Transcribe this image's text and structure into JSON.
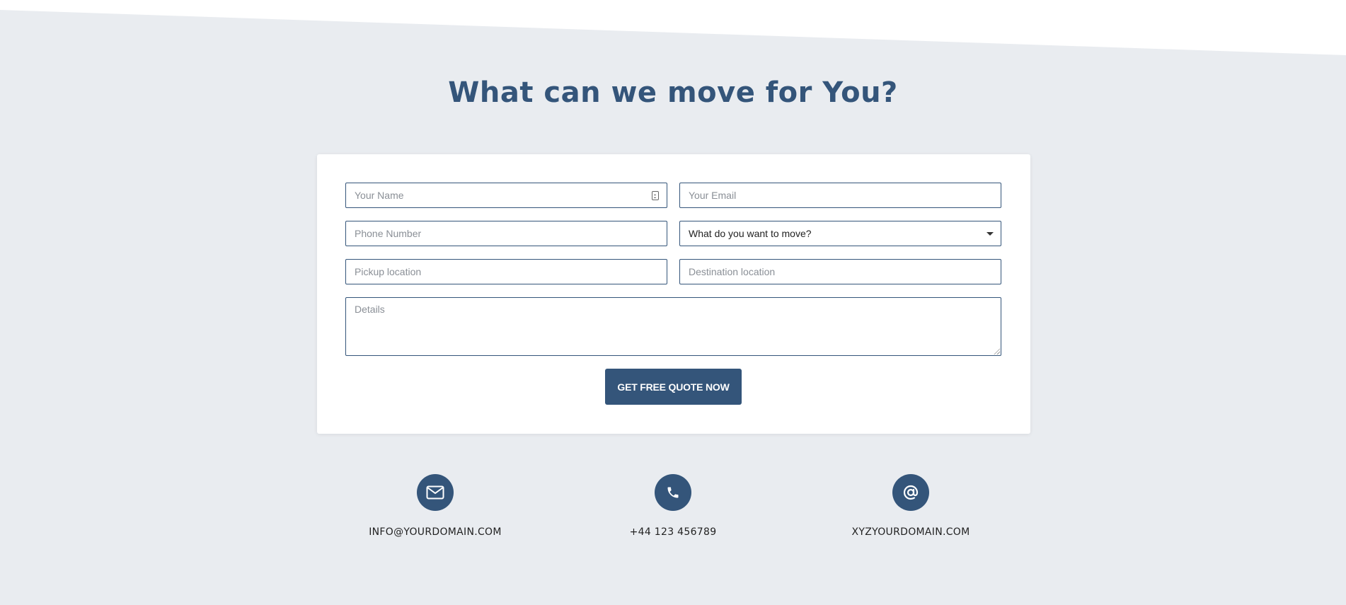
{
  "section": {
    "title": "What can we move for You?"
  },
  "form": {
    "name_placeholder": "Your Name",
    "email_placeholder": "Your Email",
    "phone_placeholder": "Phone Number",
    "move_select_value": "What do you want to move?",
    "pickup_placeholder": "Pickup location",
    "destination_placeholder": "Destination location",
    "details_placeholder": "Details",
    "submit_label": "GET FREE QUOTE NOW"
  },
  "contacts": [
    {
      "icon": "envelope-icon",
      "label": "INFO@YOURDOMAIN.COM"
    },
    {
      "icon": "phone-icon",
      "label": "+44 123 456789"
    },
    {
      "icon": "at-sign-icon",
      "label": "XYZYOURDOMAIN.COM"
    }
  ],
  "colors": {
    "background": "#e9ecf0",
    "accent": "#34557a",
    "card": "#ffffff"
  }
}
